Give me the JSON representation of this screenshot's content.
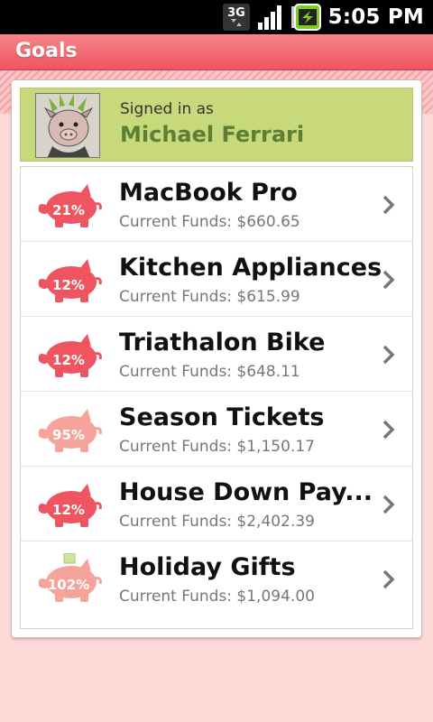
{
  "status_bar": {
    "network_icon": "3g-icon",
    "signal_icon": "signal-icon",
    "battery_icon": "battery-charging-icon",
    "time": "5:05 PM"
  },
  "title_bar": {
    "title": "Goals"
  },
  "account": {
    "signed_in_label": "Signed in as",
    "name": "Michael Ferrari",
    "avatar_icon": "pig-avatar-icon"
  },
  "colors": {
    "title_bar": "#ee5560",
    "account_banner": "#c7d97a",
    "account_name": "#5c7f35",
    "pig_strong": "#ee5560",
    "pig_light": "#f6a39c",
    "page_background": "#fcd9d6"
  },
  "goals": [
    {
      "name": "MacBook Pro",
      "funds": "Current Funds: $660.65",
      "percent": "21%",
      "pig_style": "strong"
    },
    {
      "name": "Kitchen Appliances",
      "funds": "Current Funds: $615.99",
      "percent": "12%",
      "pig_style": "strong"
    },
    {
      "name": "Triathalon Bike",
      "funds": "Current Funds: $648.11",
      "percent": "12%",
      "pig_style": "strong"
    },
    {
      "name": "Season Tickets",
      "funds": "Current Funds: $1,150.17",
      "percent": "95%",
      "pig_style": "light"
    },
    {
      "name": "House Down Pay...",
      "funds": "Current Funds: $2,402.39",
      "percent": "12%",
      "pig_style": "strong"
    },
    {
      "name": "Holiday Gifts",
      "funds": "Current Funds: $1,094.00",
      "percent": "102%",
      "pig_style": "light"
    }
  ]
}
